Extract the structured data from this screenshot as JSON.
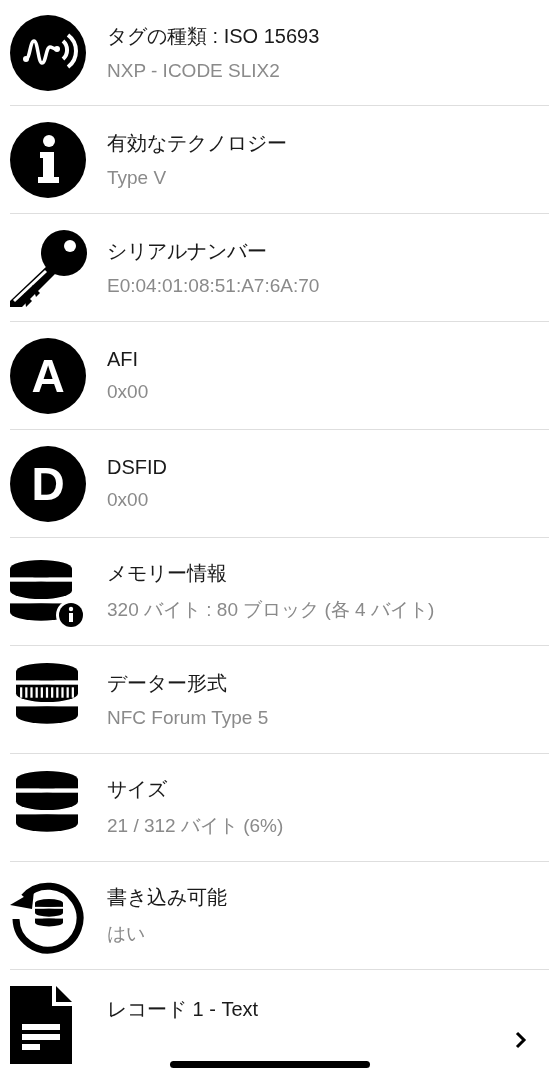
{
  "items": [
    {
      "kind": "nfc",
      "title": "タグの種類 : ISO 15693",
      "value": "NXP - ICODE SLIX2"
    },
    {
      "kind": "info",
      "title": "有効なテクノロジー",
      "value": "Type V"
    },
    {
      "kind": "key",
      "title": "シリアルナンバー",
      "value": "E0:04:01:08:51:A7:6A:70"
    },
    {
      "kind": "letter",
      "letter": "A",
      "title": "AFI",
      "value": "0x00"
    },
    {
      "kind": "letter",
      "letter": "D",
      "title": "DSFID",
      "value": "0x00"
    },
    {
      "kind": "db-info",
      "title": "メモリー情報",
      "value": "320 バイト : 80 ブロック (各 4 バイト)"
    },
    {
      "kind": "db-format",
      "title": "データー形式",
      "value": "NFC Forum Type 5"
    },
    {
      "kind": "db",
      "title": "サイズ",
      "value": "21 / 312 バイト (6%)"
    },
    {
      "kind": "db-refresh",
      "title": "書き込み可能",
      "value": "はい"
    },
    {
      "kind": "record",
      "title": "レコード 1 - Text"
    }
  ]
}
